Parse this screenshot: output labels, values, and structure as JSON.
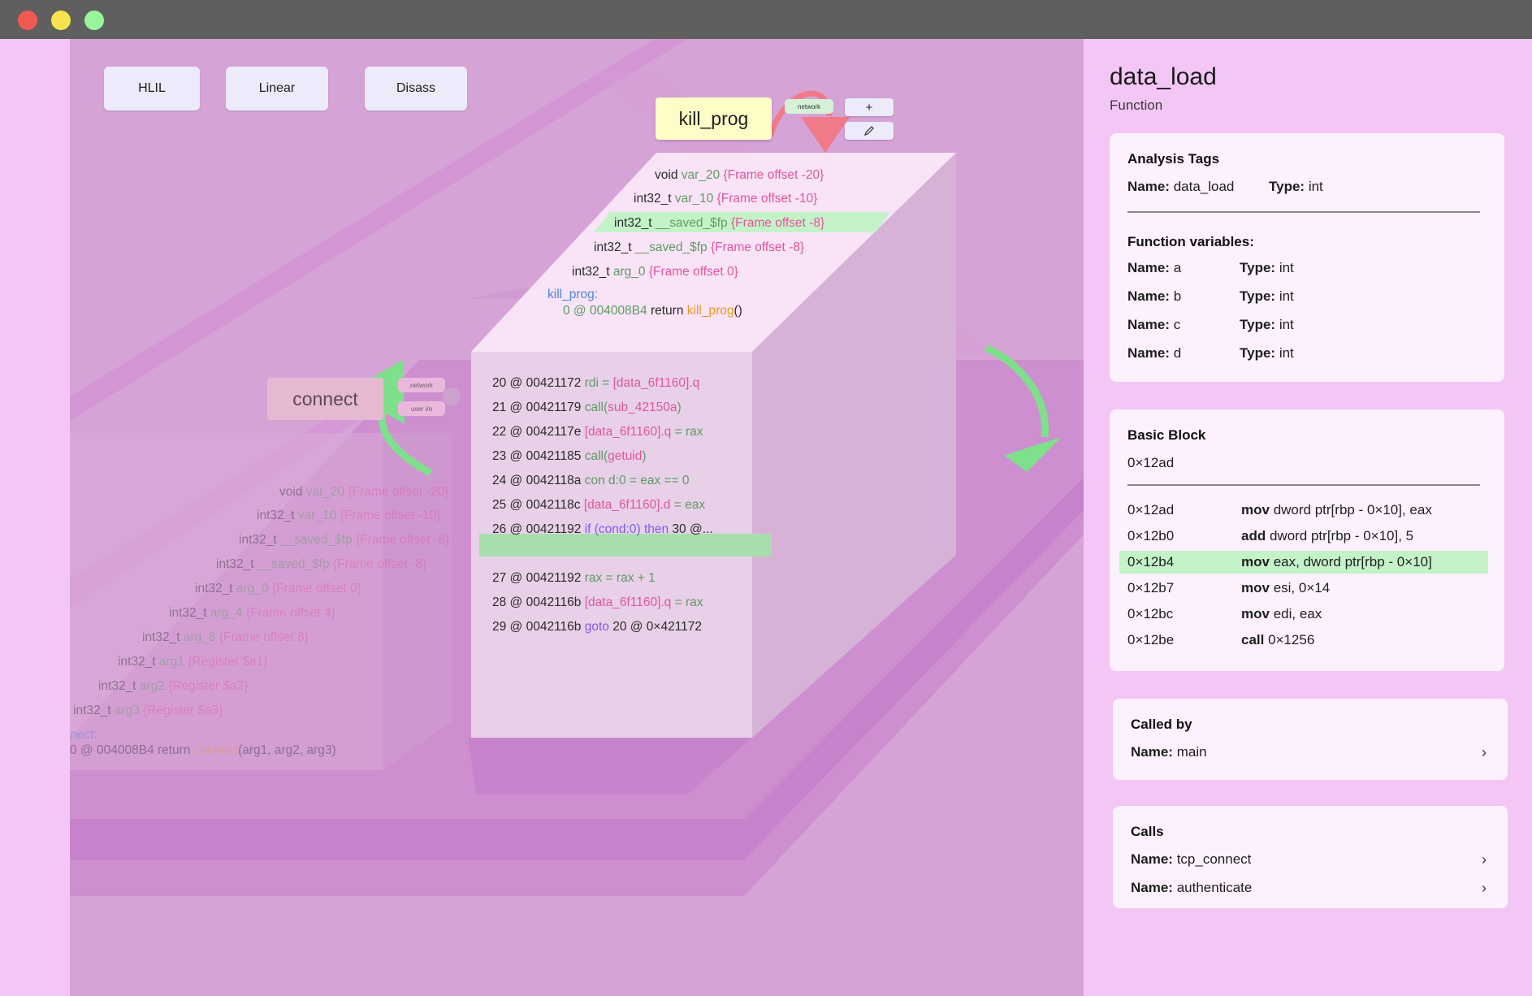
{
  "window": {
    "traffic_lights": [
      {
        "name": "close",
        "color": "#ee5a52"
      },
      {
        "name": "minimize",
        "color": "#f7e34e"
      },
      {
        "name": "zoom",
        "color": "#99f59d"
      }
    ]
  },
  "toolbar": {
    "view_buttons": [
      "HLIL",
      "Linear",
      "Disass"
    ]
  },
  "graph": {
    "kill_node": {
      "label": "kill_prog",
      "tag": "network",
      "plus_label": "+",
      "edit_icon": "pencil-icon",
      "vars": [
        {
          "type": "void",
          "name": "var_20",
          "note": "{Frame offset -20}"
        },
        {
          "type": "int32_t",
          "name": "var_10",
          "note": "{Frame offset -10}"
        },
        {
          "type": "int32_t",
          "name": "__saved_$fp",
          "note": "{Frame offset -8}"
        },
        {
          "type": "int32_t",
          "name": "__saved_$fp",
          "note": "{Frame offset -8}"
        },
        {
          "type": "int32_t",
          "name": "arg_0",
          "note": "{Frame offset 0}"
        }
      ],
      "func_label": "kill_prog:",
      "ret_prefix": "0 @ ",
      "ret_addr": "004008B4",
      "ret_word": " return ",
      "ret_func": "kill_prog",
      "ret_suffix": "()"
    },
    "il_lines": [
      {
        "idx": "20 @ 00421172 ",
        "a": "rdi = ",
        "b": "[data_6f1160].q",
        "c": ""
      },
      {
        "idx": "21 @ 00421179 ",
        "a": "call(",
        "b": "sub_42150a",
        "c": ")"
      },
      {
        "idx": "22 @ 0042117e ",
        "a": "",
        "b": "[data_6f1160].q",
        "c": " = rax"
      },
      {
        "idx": "23 @ 00421185 ",
        "a": "call(",
        "b": "getuid",
        "c": ")"
      },
      {
        "idx": "24 @ 0042118a ",
        "a": "con d:0 = eax == 0",
        "b": "",
        "c": ""
      },
      {
        "idx": "25 @ 0042118c ",
        "a": "",
        "b": "[data_6f1160].d",
        "c": " = eax"
      },
      {
        "idx": "26 @ 00421192 ",
        "a": "if (cond:0) then",
        "b": "",
        "c": " 30 @..."
      },
      {
        "idx": "27 @ 00421192 ",
        "a": "rax = rax + 1",
        "b": "",
        "c": ""
      },
      {
        "idx": "28 @ 0042116b ",
        "a": "",
        "b": "[data_6f1160].q",
        "c": " = rax"
      },
      {
        "idx": "29 @ 0042116b ",
        "a": "goto",
        "b": "",
        "c": " 20 @ 0×421172"
      }
    ],
    "connect_node": {
      "label": "connect",
      "tags": [
        "network",
        "user i/o"
      ],
      "vars": [
        {
          "type": "void",
          "name": "var_20",
          "note": "{Frame offset -20}"
        },
        {
          "type": "int32_t",
          "name": "var_10",
          "note": "{Frame offset -10}"
        },
        {
          "type": "int32_t",
          "name": "__saved_$fp",
          "note": "{Frame offset -8}"
        },
        {
          "type": "int32_t",
          "name": "__saved_$fp",
          "note": "{Frame offset -8}"
        },
        {
          "type": "int32_t",
          "name": "arg_0",
          "note": "{Frame offset 0}"
        },
        {
          "type": "int32_t",
          "name": "arg_4",
          "note": "{Frame offset 4}"
        },
        {
          "type": "int32_t",
          "name": "arg_8",
          "note": "{Frame offset 8}"
        },
        {
          "type": "int32_t",
          "name": "arg1",
          "note": "{Register $a1}"
        },
        {
          "type": "int32_t",
          "name": "arg2",
          "note": "{Register $a2}"
        },
        {
          "type": "int32_t",
          "name": "arg3",
          "note": "{Register $a3}"
        }
      ],
      "func_label": "nect:",
      "ret_line_prefix": "0 @ 004008B4 return ",
      "ret_func": "connect",
      "ret_suffix": "(arg1, arg2, arg3)"
    }
  },
  "panel": {
    "title": "data_load",
    "subtitle": "Function",
    "analysis": {
      "title": "Analysis Tags",
      "name_key": "Name:",
      "name_val": "data_load",
      "type_key": "Type:",
      "type_val": "int",
      "vars_title": "Function variables:",
      "vars": [
        {
          "name": "a",
          "type": "int"
        },
        {
          "name": "b",
          "type": "int"
        },
        {
          "name": "c",
          "type": "int"
        },
        {
          "name": "d",
          "type": "int"
        }
      ]
    },
    "basic_block": {
      "title": "Basic Block",
      "address": "0×12ad",
      "rows": [
        {
          "addr": "0×12ad",
          "op": "mov",
          "args": " dword ptr[rbp - 0×10], eax"
        },
        {
          "addr": "0×12b0",
          "op": "add",
          "args": " dword ptr[rbp - 0×10], 5"
        },
        {
          "addr": "0×12b4",
          "op": "mov",
          "args": " eax, dword ptr[rbp - 0×10]"
        },
        {
          "addr": "0×12b7",
          "op": "mov",
          "args": " esi, 0×14"
        },
        {
          "addr": "0×12bc",
          "op": "mov",
          "args": " edi, eax"
        },
        {
          "addr": "0×12be",
          "op": "call",
          "args": " 0×1256"
        }
      ]
    },
    "called_by": {
      "title": "Called by",
      "items": [
        {
          "key": "Name:",
          "val": "main"
        }
      ]
    },
    "calls": {
      "title": "Calls",
      "items": [
        {
          "key": "Name:",
          "val": "tcp_connect"
        },
        {
          "key": "Name:",
          "val": "authenticate"
        }
      ]
    },
    "chevron": "›"
  },
  "colors": {
    "canvas_bg": "#d6a3d6",
    "panel_bg": "#f3c6f5",
    "highlight": "#c5f3c9",
    "arrow_green": "#7ee08a",
    "arrow_red": "#f07a8a"
  }
}
